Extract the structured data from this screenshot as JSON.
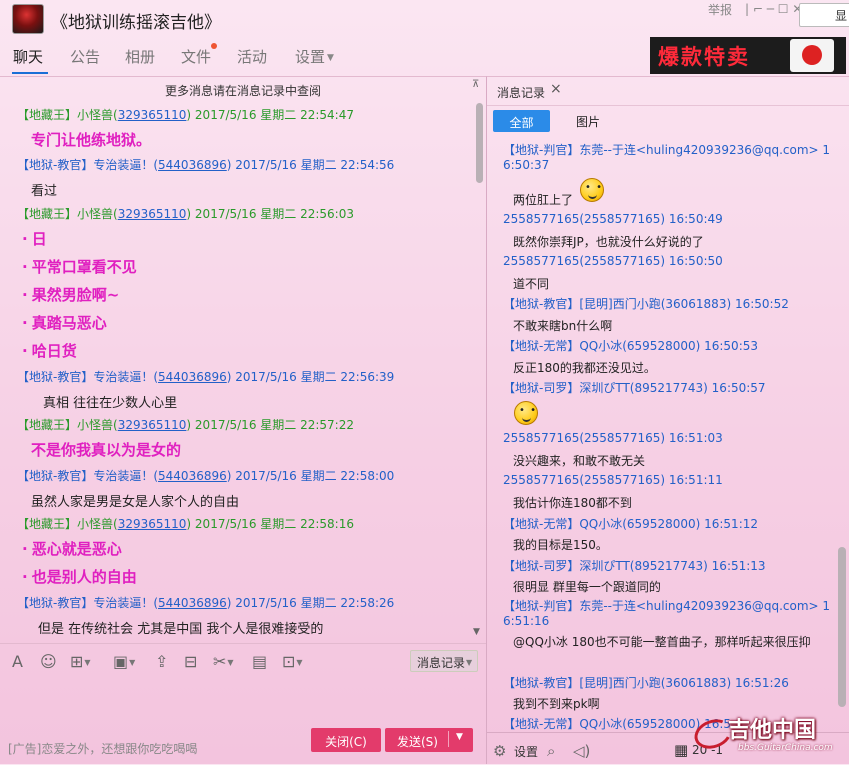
{
  "header": {
    "group_title": "《地狱训练摇滚吉他》",
    "report": "举报",
    "window_controls": "| ⌐ ─ ☐ ✕",
    "show_button": "显",
    "tabs": [
      {
        "label": "聊天",
        "active": true
      },
      {
        "label": "公告"
      },
      {
        "label": "相册"
      },
      {
        "label": "文件",
        "badge": true
      },
      {
        "label": "活动"
      },
      {
        "label": "设置",
        "dropdown": true
      }
    ],
    "ad_banner_text": "爆款特卖"
  },
  "chat": {
    "more_messages": "更多消息请在消息记录中查阅",
    "messages": [
      {
        "role": "【地藏王】",
        "name": "小怪兽(",
        "qq": "329365110",
        "time": ")  2017/5/16 星期二 22:54:47",
        "color": "green"
      },
      {
        "role": "【地狱-教官】",
        "name": "专治装逼！(",
        "qq": "544036896",
        "time": ")  2017/5/16 星期二 22:54:56",
        "color": "blue"
      },
      {
        "role": "【地藏王】",
        "name": "小怪兽(",
        "qq": "329365110",
        "time": ")  2017/5/16 星期二 22:56:03",
        "color": "green"
      },
      {
        "role": "【地狱-教官】",
        "name": "专治装逼！(",
        "qq": "544036896",
        "time": ")  2017/5/16 星期二 22:56:39",
        "color": "blue"
      },
      {
        "role": "【地藏王】",
        "name": "小怪兽(",
        "qq": "329365110",
        "time": ")  2017/5/16 星期二 22:57:22",
        "color": "green"
      },
      {
        "role": "【地狱-教官】",
        "name": "专治装逼！(",
        "qq": "544036896",
        "time": ")  2017/5/16 星期二 22:58:00",
        "color": "blue"
      },
      {
        "role": "【地藏王】",
        "name": "小怪兽(",
        "qq": "329365110",
        "time": ")  2017/5/16 星期二 22:58:16",
        "color": "green"
      },
      {
        "role": "【地狱-教官】",
        "name": "专治装逼！(",
        "qq": "544036896",
        "time": ")  2017/5/16 星期二 22:58:26",
        "color": "blue"
      }
    ],
    "bodies": {
      "m1": "专门让他练地狱。",
      "m2": "看过",
      "m3_lines": [
        "日",
        "平常口罩看不见",
        "果然男脸啊~",
        "真踏马恶心",
        "哈日货"
      ],
      "m4": "真相  往往在少数人心里",
      "m5": "不是你我真以为是女的",
      "m6": "虽然人家是男是女是人家个人的自由",
      "m7_lines": [
        "恶心就是恶心",
        "也是别人的自由"
      ],
      "m8": "但是   在传统社会  尤其是中国   我个人是很难接受的"
    }
  },
  "toolbar": {
    "history_label": "消息记录",
    "icons": [
      "font-icon",
      "emoji-icon",
      "gift-icon",
      "image-icon",
      "upload-icon",
      "shop-icon",
      "scissors-icon",
      "document-icon",
      "screen-record-icon"
    ]
  },
  "footer": {
    "ad_line": "[广告]恋爱之外，还想跟你吃吃喝喝",
    "close_label": "关闭(C)",
    "send_label": "发送(S)"
  },
  "history": {
    "tab_label": "消息记录",
    "filter_all": "全部",
    "filter_pictures": "图片",
    "entries": [
      {
        "header": "【地狱-判官】东莞--于连<huling420939236@qq.com> 16:50:37",
        "body": "两位肛上了"
      },
      {
        "header": "2558577165(2558577165) 16:50:49",
        "body": "既然你崇拜JP，也就没什么好说的了"
      },
      {
        "header": "2558577165(2558577165) 16:50:50",
        "body": "道不同"
      },
      {
        "header": "【地狱-教官】[昆明]西门小跑(36061883) 16:50:52",
        "body": "不敢来瞎bn什么啊"
      },
      {
        "header": "【地狱-无常】QQ小冰(659528000) 16:50:53",
        "body": "反正180的我都还没见过。"
      },
      {
        "header": "【地狱-司罗】深圳ぴTT(895217743) 16:50:57",
        "body": ""
      },
      {
        "header": "2558577165(2558577165) 16:51:03",
        "body": "没兴趣来，和敢不敢无关"
      },
      {
        "header": "2558577165(2558577165) 16:51:11",
        "body": "我估计你连180都不到"
      },
      {
        "header": "【地狱-无常】QQ小冰(659528000) 16:51:12",
        "body": "我的目标是150。"
      },
      {
        "header": "【地狱-司罗】深圳ぴTT(895217743) 16:51:13",
        "body": "很明显 群里每一个跟道同的"
      },
      {
        "header": "【地狱-判官】东莞--于连<huling420939236@qq.com> 16:51:16",
        "body": "@QQ小冰 180也不可能一整首曲子，那样听起来很压抑"
      },
      {
        "header": "【地狱-教官】[昆明]西门小跑(36061883) 16:51:26",
        "body": "我到不到来pk啊"
      },
      {
        "header": "【地狱-无常】QQ小冰(659528000) 16:5",
        "body": ""
      }
    ],
    "settings_label": "设置",
    "date_partial": "20 -1"
  },
  "watermark": {
    "title": "吉他中国",
    "url": "bbs.GuitarChina.com"
  }
}
